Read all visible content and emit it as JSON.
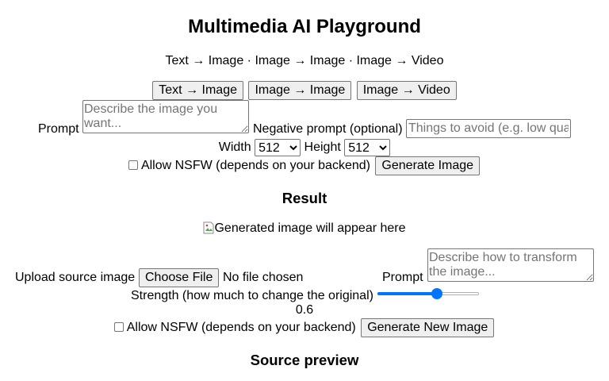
{
  "page": {
    "title": "Multimedia AI Playground",
    "subtitle": "Text → Image · Image → Image · Image → Video"
  },
  "tabs": [
    {
      "label": "Text → Image"
    },
    {
      "label": "Image → Image"
    },
    {
      "label": "Image → Video"
    }
  ],
  "text_to_image": {
    "prompt_label": "Prompt",
    "prompt_placeholder": "Describe the image you want...",
    "negative_label": "Negative prompt (optional)",
    "negative_placeholder": "Things to avoid (e.g. low quality, blurry)",
    "width_label": "Width",
    "width_value": "512",
    "height_label": "Height",
    "height_value": "512",
    "nsfw_label": "Allow NSFW (depends on your backend)",
    "nsfw_checked": false,
    "generate_label": "Generate Image"
  },
  "result": {
    "heading": "Result",
    "image_alt": "Generated image will appear here"
  },
  "image_to_image": {
    "upload_label": "Upload source image",
    "choose_file_label": "Choose File",
    "file_status": "No file chosen",
    "prompt_label": "Prompt",
    "prompt_placeholder": "Describe how to transform the image...",
    "strength_label": "Strength (how much to change the original)",
    "strength_value": 0.6,
    "strength_display": "0.6",
    "nsfw_label": "Allow NSFW (depends on your backend)",
    "nsfw_checked": false,
    "generate_label": "Generate New Image"
  },
  "source_preview": {
    "heading": "Source preview"
  }
}
